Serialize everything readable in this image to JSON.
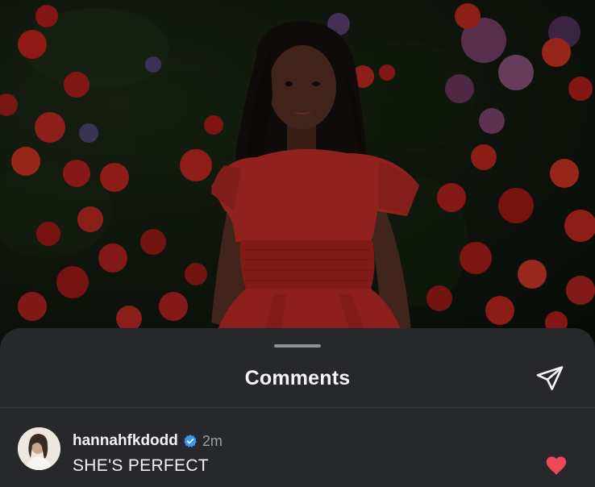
{
  "sheet": {
    "title": "Comments",
    "send_icon": "paper-plane-icon"
  },
  "comments": [
    {
      "username": "hannahfkdodd",
      "verified": true,
      "time": "2m",
      "text": "SHE'S PERFECT",
      "liked": true,
      "like_color": "#ed4956"
    }
  ],
  "colors": {
    "sheet_bg": "#26282c",
    "verified_blue": "#3897f0",
    "dress_red": "#c8302a"
  }
}
